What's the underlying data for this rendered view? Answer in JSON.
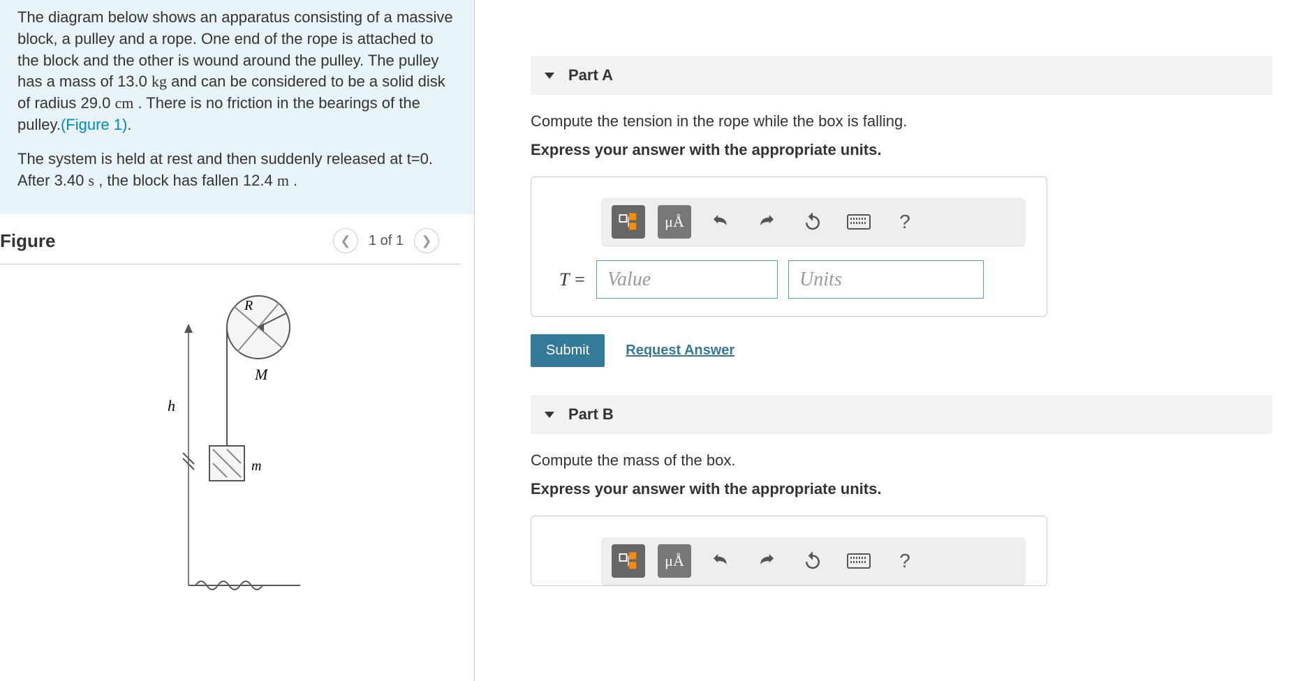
{
  "problem": {
    "p1_a": "The diagram below shows an apparatus consisting of a massive block, a pulley and a rope. One end of the rope is attached to the block and the other is wound around the pulley. The pulley has a mass of 13.0 ",
    "p1_unit1": "kg",
    "p1_b": " and can be considered to be a solid disk of radius 29.0 ",
    "p1_unit2": "cm",
    "p1_c": " . There is no friction in the bearings of the pulley.",
    "fig_link": "(Figure 1)",
    "p1_d": ".",
    "p2_a": "The system is held at rest and then suddenly released at t=0. After 3.40 ",
    "p2_unit1": "s",
    "p2_b": " , the block has fallen 12.4 ",
    "p2_unit2": "m",
    "p2_c": " ."
  },
  "figure": {
    "title": "Figure",
    "counter": "1 of 1",
    "labels": {
      "R": "R",
      "M": "M",
      "h": "h",
      "m": "m"
    }
  },
  "partA": {
    "title": "Part A",
    "question": "Compute the tension in the rope while the box is falling.",
    "instruction": "Express your answer with the appropriate units.",
    "var": "T = ",
    "value_ph": "Value",
    "units_ph": "Units",
    "submit": "Submit",
    "request": "Request Answer",
    "mu": "μÅ"
  },
  "partB": {
    "title": "Part B",
    "question": "Compute the mass of the box.",
    "instruction": "Express your answer with the appropriate units.",
    "mu": "μÅ"
  }
}
